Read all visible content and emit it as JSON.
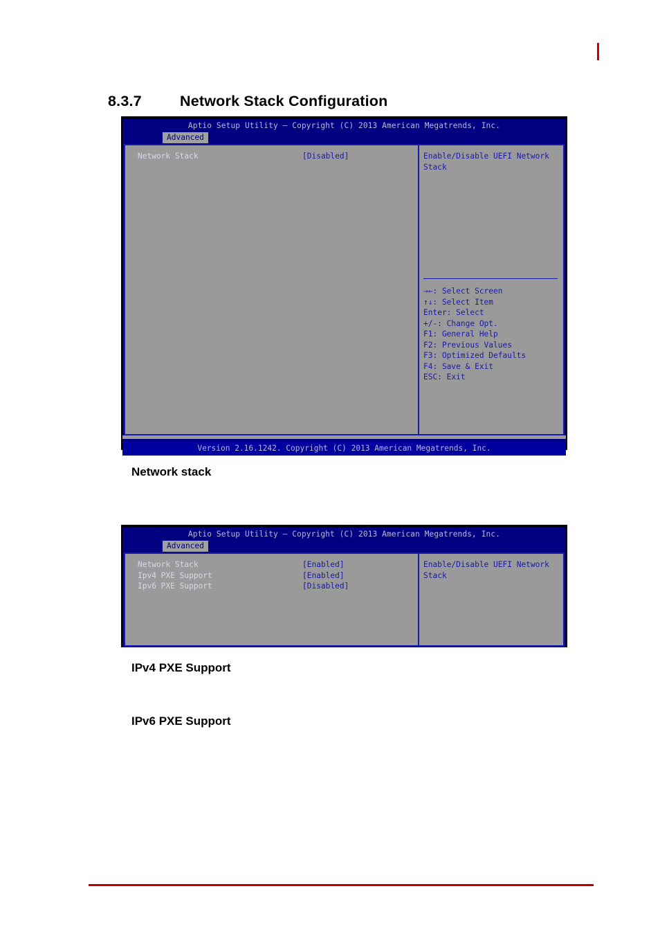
{
  "heading": {
    "number": "8.3.7",
    "title": "Network Stack Configuration"
  },
  "captions": {
    "network_stack": "Network stack",
    "ipv4": "IPv4 PXE Support",
    "ipv6": "IPv6 PXE Support"
  },
  "bios_common": {
    "title": "Aptio Setup Utility – Copyright (C) 2013 American Megatrends, Inc.",
    "tab": "Advanced",
    "help_line1": "Enable/Disable UEFI Network",
    "help_line2": "Stack",
    "footer": "Version 2.16.1242. Copyright (C) 2013 American Megatrends, Inc.",
    "keys": [
      "→←: Select Screen",
      "↑↓: Select Item",
      "Enter: Select",
      "+/-: Change Opt.",
      "F1: General Help",
      "F2: Previous Values",
      "F3: Optimized Defaults",
      "F4: Save & Exit",
      "ESC: Exit"
    ]
  },
  "screenshot_1": {
    "options": [
      {
        "label": "Network Stack",
        "value": "[Disabled]"
      }
    ]
  },
  "screenshot_2": {
    "options": [
      {
        "label": "Network Stack",
        "value": "[Enabled]"
      },
      {
        "label": "Ipv4 PXE Support",
        "value": "[Enabled]"
      },
      {
        "label": "Ipv6 PXE Support",
        "value": "[Disabled]"
      }
    ]
  },
  "colors": {
    "bios_blue": "#000080",
    "bios_grey": "#9a9a9a",
    "accent_red": "#cc0000",
    "text_blue": "#1a1aa8"
  }
}
